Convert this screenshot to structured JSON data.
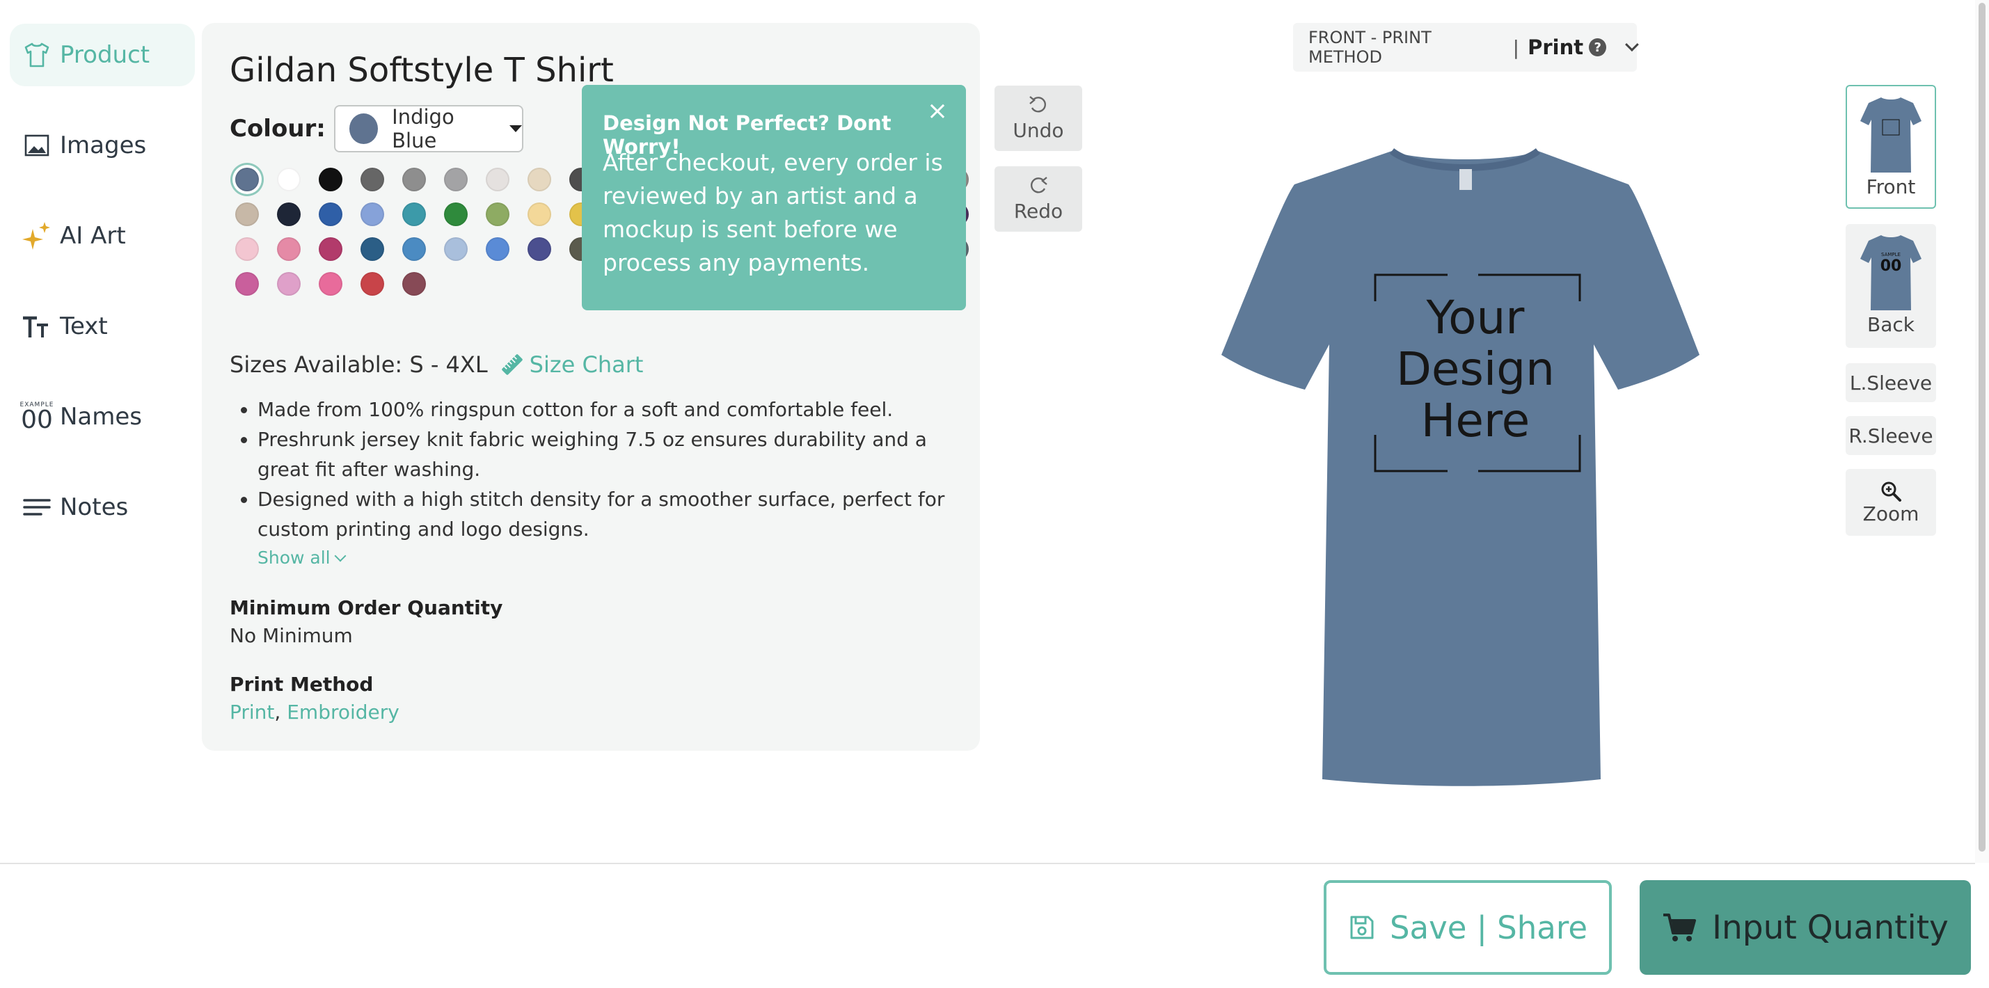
{
  "sidebar": {
    "items": [
      {
        "label": "Product",
        "icon": "tshirt-icon",
        "active": true
      },
      {
        "label": "Images",
        "icon": "image-icon"
      },
      {
        "label": "AI Art",
        "icon": "sparkles-icon"
      },
      {
        "label": "Text",
        "icon": "text-icon"
      },
      {
        "label": "Names",
        "icon": "names-number-icon",
        "icon_caption": "EXAMPLE",
        "icon_number": "00"
      },
      {
        "label": "Notes",
        "icon": "notes-icon"
      }
    ]
  },
  "product": {
    "title": "Gildan Softstyle T Shirt",
    "colour_label": "Colour:",
    "selected_colour": "Indigo Blue",
    "selected_colour_hex": "#5f7390",
    "swatch_rows": [
      [
        "#5f7390",
        "#ffffff",
        "#111111",
        "#666666",
        "#8e8e8e",
        "#a3a3a5",
        "#e5e1df",
        "#e6d8c0",
        "#4e4e4e",
        "#b6a79a",
        "#a7aab0",
        "#8f8f8f",
        "#5a4a3c",
        "#4b5a3a",
        "#c9a8a0",
        "#bbbbbb",
        "#dad8d2",
        "#8e8a86"
      ],
      [
        "#c7b8a7",
        "#1e2637",
        "#2f5fa7",
        "#86a2d9",
        "#3c9aa9",
        "#2f8a3c",
        "#8eab63",
        "#f3d899",
        "#e3c24a",
        "#e08a2f",
        "#d86f2e",
        "#c44a2a",
        "#d65a46",
        "#b8363a",
        "#8e2b33",
        "#6b2332",
        "#7d3b5f",
        "#4a2f5b"
      ],
      [
        "#f3c6d1",
        "#e58aa6",
        "#b23b6b",
        "#2b5e86",
        "#4b8bc2",
        "#a9bfdc",
        "#5a8bd6",
        "#4b4f8f",
        "#5b5b4d",
        "#7b6f55",
        "#9a8c6e",
        "#5b7051",
        "#3f5c48",
        "#3d3f3b",
        "#7b8c8e",
        "#6a7d86",
        "#4c6a7d",
        "#5d6a70"
      ],
      [
        "#c95f9c",
        "#dfa0c9",
        "#e86b9b",
        "#c84449",
        "#874a56"
      ]
    ],
    "sizes": "Sizes Available: S - 4XL",
    "size_chart_label": "Size Chart",
    "features": [
      "Made from 100% ringspun cotton for a soft and comfortable feel.",
      "Preshrunk jersey knit fabric weighing 7.5 oz ensures durability and a great fit after washing.",
      "Designed with a high stitch density for a smoother surface, perfect for custom printing and logo designs."
    ],
    "show_all": "Show all",
    "moq_heading": "Minimum Order Quantity",
    "moq_value": "No Minimum",
    "print_method_heading": "Print Method",
    "print_methods": [
      "Print",
      "Embroidery"
    ],
    "print_methods_separator": ", "
  },
  "popover": {
    "title": "Design Not Perfect? Dont Worry!",
    "body": "After checkout, every order is reviewed by an artist and a mockup is sent before we process any payments.",
    "close": "×"
  },
  "history": {
    "undo": "Undo",
    "redo": "Redo"
  },
  "canvas": {
    "print_method_label": "FRONT - PRINT METHOD",
    "separator": "|",
    "print_method_value": "Print",
    "help": "?",
    "design_placeholder": [
      "Your",
      "Design",
      "Here"
    ],
    "shirt_color": "#5f7a98"
  },
  "views": {
    "front": "Front",
    "back": "Back",
    "back_thumb_caption": "SAMPLE",
    "back_thumb_number": "00",
    "left_sleeve": "L.Sleeve",
    "right_sleeve": "R.Sleeve",
    "zoom": "Zoom"
  },
  "actions": {
    "save_share": "Save | Share",
    "input_quantity": "Input Quantity"
  },
  "colors": {
    "accent": "#55b6a4",
    "popover_bg": "#6fc1b0",
    "primary_button": "#4f9c8c"
  }
}
